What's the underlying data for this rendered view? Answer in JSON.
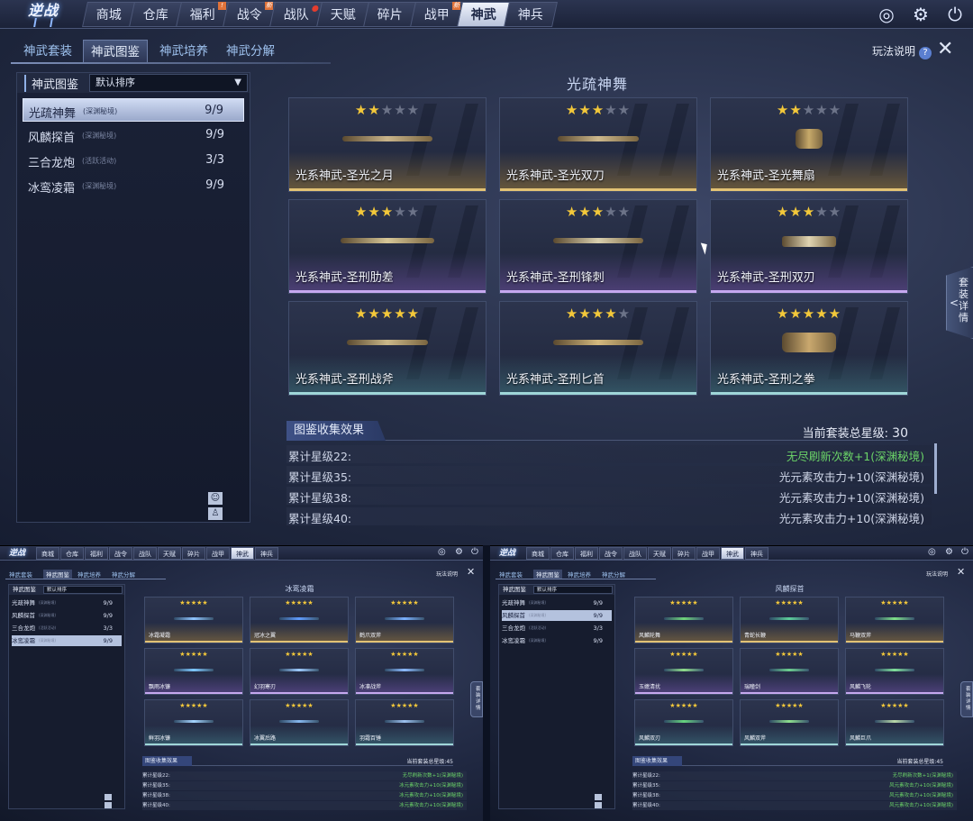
{
  "nav": {
    "logo": "逆战",
    "tabs": [
      {
        "label": "商城"
      },
      {
        "label": "仓库"
      },
      {
        "label": "福利",
        "badge": "!"
      },
      {
        "label": "战令",
        "badge": "新"
      },
      {
        "label": "战队",
        "dot": true
      },
      {
        "label": "天赋"
      },
      {
        "label": "碎片"
      },
      {
        "label": "战甲",
        "badge": "新"
      },
      {
        "label": "神武",
        "active": true
      },
      {
        "label": "神兵"
      }
    ],
    "icons": [
      "compass-icon",
      "gear-icon",
      "power-icon"
    ]
  },
  "subtabs": {
    "items": [
      "神武套装",
      "神武图鉴",
      "神武培养",
      "神武分解"
    ],
    "active_index": 1,
    "help_label": "玩法说明",
    "help_icon": "?"
  },
  "left_panel": {
    "title": "神武图鉴",
    "sort_label": "默认排序",
    "items": [
      {
        "name": "光疏神舞",
        "tag": "(深渊秘境)",
        "count": "9/9"
      },
      {
        "name": "风麟探首",
        "tag": "(深渊秘境)",
        "count": "9/9"
      },
      {
        "name": "三合龙炮",
        "tag": "(活跃活动)",
        "count": "3/3"
      },
      {
        "name": "冰鸾凌霜",
        "tag": "(深渊秘境)",
        "count": "9/9"
      }
    ],
    "active_index": 0,
    "bottom_icons": [
      "smile-icon",
      "figure-icon"
    ]
  },
  "main": {
    "set_title": "光疏神舞",
    "cards": [
      {
        "name": "光系神武-圣光之月",
        "stars": 2,
        "row": "gold",
        "weapon_color": "#c9b48a"
      },
      {
        "name": "光系神武-圣光双刀",
        "stars": 3,
        "row": "gold",
        "weapon_color": "#cdb88c"
      },
      {
        "name": "光系神武-圣光舞扇",
        "stars": 2,
        "row": "gold",
        "weapon_color": "#c7a96a"
      },
      {
        "name": "光系神武-圣刑肋差",
        "stars": 3,
        "row": "purple",
        "weapon_color": "#d6c697"
      },
      {
        "name": "光系神武-圣刑锋刺",
        "stars": 3,
        "row": "purple",
        "weapon_color": "#d9cfae"
      },
      {
        "name": "光系神武-圣刑双刃",
        "stars": 3,
        "row": "purple",
        "weapon_color": "#e0d4b2"
      },
      {
        "name": "光系神武-圣刑战斧",
        "stars": 5,
        "row": "teal",
        "weapon_color": "#cbb889"
      },
      {
        "name": "光系神武-圣刑匕首",
        "stars": 4,
        "row": "teal",
        "weapon_color": "#d4b97e"
      },
      {
        "name": "光系神武-圣刑之拳",
        "stars": 5,
        "row": "teal",
        "weapon_color": "#c9a86e"
      }
    ],
    "effects_title": "图鉴收集效果",
    "total_label": "当前套装总星级:",
    "total_value": "30",
    "effects": [
      {
        "label": "累计星级22:",
        "value": "无尽刷新次数+1(深渊秘境)",
        "active": true
      },
      {
        "label": "累计星级35:",
        "value": "光元素攻击力+10(深渊秘境)",
        "active": false
      },
      {
        "label": "累计星级38:",
        "value": "光元素攻击力+10(深渊秘境)",
        "active": false
      },
      {
        "label": "累计星级40:",
        "value": "光元素攻击力+10(深渊秘境)",
        "active": false
      }
    ],
    "side_tab": {
      "arrow": "<",
      "label": "套装详情"
    }
  },
  "minis": [
    {
      "set_title": "冰鸾凌霜",
      "active_index": 3,
      "notice": "",
      "total_value": "45",
      "cards": [
        {
          "name": "冰霜凝霜",
          "color": "#8fc4ff"
        },
        {
          "name": "冠冰之翼",
          "color": "#5f9cff"
        },
        {
          "name": "鹤爪双斧",
          "color": "#7ab0ff"
        },
        {
          "name": "飘雨冰镰",
          "color": "#7ec8ff"
        },
        {
          "name": "幻羽寒刃",
          "color": "#9ecbff"
        },
        {
          "name": "冰凛战斧",
          "color": "#8cbaff"
        },
        {
          "name": "鲜羽冰镰",
          "color": "#a5d4ff"
        },
        {
          "name": "冰翼后路",
          "color": "#86b8f0"
        },
        {
          "name": "羽霜百锤",
          "color": "#9cc0ee"
        }
      ],
      "effects": [
        {
          "label": "累计星级22:",
          "value": "无尽刷新次数+1(深渊秘境)",
          "active": true
        },
        {
          "label": "累计星级35:",
          "value": "冰元素攻击力+10(深渊秘境)",
          "active": true
        },
        {
          "label": "累计星级38:",
          "value": "冰元素攻击力+10(深渊秘境)",
          "active": true
        },
        {
          "label": "累计星级40:",
          "value": "冰元素攻击力+10(深渊秘境)",
          "active": true
        }
      ]
    },
    {
      "set_title": "风麟探首",
      "active_index": 1,
      "notice": "",
      "total_value": "45",
      "cards": [
        {
          "name": "风麟轮舞",
          "color": "#6fd47a"
        },
        {
          "name": "青蛇长鞭",
          "color": "#5ccf9a"
        },
        {
          "name": "马鞭双斧",
          "color": "#7ee088"
        },
        {
          "name": "玉嬷清扰",
          "color": "#8fdc8a"
        },
        {
          "name": "瑞瞳剑",
          "color": "#6ccf8f"
        },
        {
          "name": "风麟飞轮",
          "color": "#7fe09a"
        },
        {
          "name": "风麟双刃",
          "color": "#66d47e"
        },
        {
          "name": "风麟双斧",
          "color": "#8ee08e"
        },
        {
          "name": "风麟巨爪",
          "color": "#b8d8a8"
        }
      ],
      "effects": [
        {
          "label": "累计星级22:",
          "value": "无尽刷新次数+1(深渊秘境)",
          "active": true
        },
        {
          "label": "累计星级35:",
          "value": "风元素攻击力+10(深渊秘境)",
          "active": true
        },
        {
          "label": "累计星级38:",
          "value": "风元素攻击力+10(深渊秘境)",
          "active": true
        },
        {
          "label": "累计星级40:",
          "value": "风元素攻击力+10(深渊秘境)",
          "active": true
        }
      ]
    }
  ],
  "colors": {
    "star_on": "#f3c83a",
    "star_off": "#6c7388",
    "effect_active": "#6bd468"
  }
}
